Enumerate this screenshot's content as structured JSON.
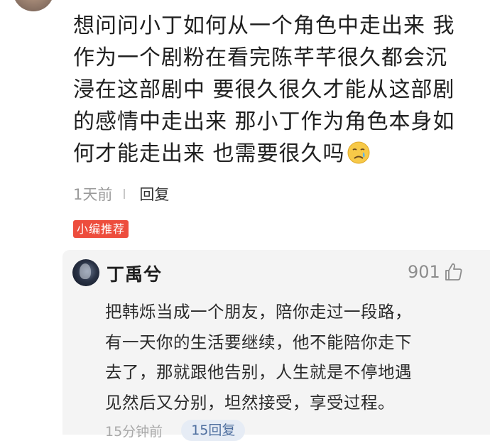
{
  "comment": {
    "lines": [
      "想问问小丁如何从一个角色中走出来 我",
      "作为一个剧粉在看完陈芊芊很久都会沉",
      "浸在这部剧中 要很久很久才能从这部剧",
      "的感情中走出来 那小丁作为角色本身如",
      "何才能走出来 也需要很久吗"
    ],
    "emoji_icon": "crying-face-emoji",
    "time": "1天前",
    "reply_label": "回复",
    "badge": "小编推荐"
  },
  "reply": {
    "author": "丁禹兮",
    "likes": "901",
    "like_icon": "thumbs-up-icon",
    "lines": [
      "把韩烁当成一个朋友，陪你走过一段路，",
      "有一天你的生活要继续，他不能陪你走下",
      "去了，那就跟他告别，人生就是不停地遇",
      "见然后又分别，坦然接受，享受过程。"
    ],
    "time": "15分钟前",
    "replies_count": "15回复"
  },
  "colors": {
    "badge_bg": "#ed4d3d",
    "reply_bg": "#f4f4f4",
    "pill_text": "#4f6f9f"
  }
}
